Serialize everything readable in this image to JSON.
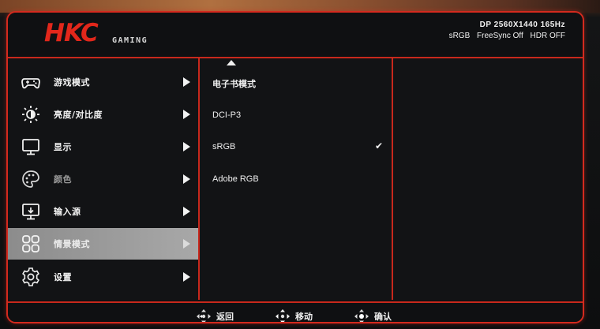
{
  "header": {
    "logo": "HKC",
    "sub_logo": "GAMING",
    "signal": "DP 2560X1440 165Hz",
    "status": [
      "sRGB",
      "FreeSync Off",
      "HDR OFF"
    ]
  },
  "menu": [
    {
      "label": "游戏模式",
      "icon": "gamepad-icon"
    },
    {
      "label": "亮度/对比度",
      "icon": "brightness-icon"
    },
    {
      "label": "显示",
      "icon": "monitor-icon"
    },
    {
      "label": "颜色",
      "icon": "palette-icon",
      "dimmed": true
    },
    {
      "label": "输入源",
      "icon": "input-source-icon"
    },
    {
      "label": "情景模式",
      "icon": "scene-mode-icon",
      "selected": true
    },
    {
      "label": "设置",
      "icon": "gear-icon"
    }
  ],
  "options": [
    {
      "label": "电子书模式"
    },
    {
      "label": "DCI-P3"
    },
    {
      "label": "sRGB",
      "checked": true
    },
    {
      "label": "Adobe RGB"
    }
  ],
  "check_mark": "✔",
  "footer": {
    "back": "返回",
    "move": "移动",
    "confirm": "确认"
  },
  "colors": {
    "accent": "#d42a1e",
    "selected_bg": "#9a9a9a",
    "panel_bg": "#121315"
  }
}
